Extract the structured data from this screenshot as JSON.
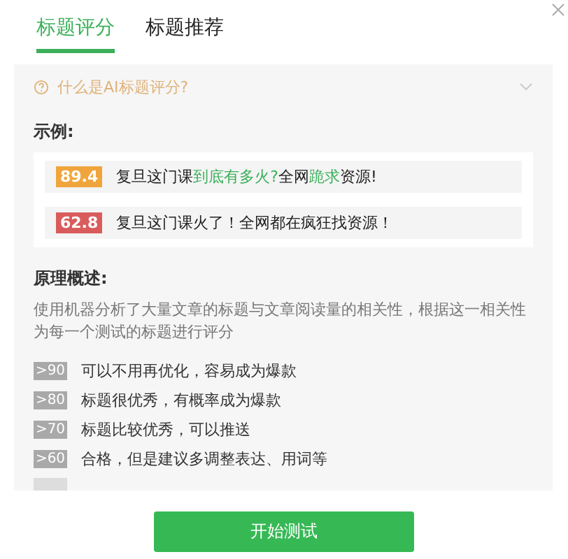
{
  "tabs": [
    {
      "label": "标题评分",
      "selected": true
    },
    {
      "label": "标题推荐",
      "selected": false
    }
  ],
  "faq": {
    "question": "什么是AI标题评分?",
    "expanded": false
  },
  "examples_heading": "示例:",
  "examples": [
    {
      "score": "89.4",
      "title": "复旦这门课**到底有多火?**全网**跪求**资源!",
      "color": "#f0a53c"
    },
    {
      "score": "62.8",
      "title": "复旦这门课火了！全网都在疯狂找资源！",
      "color": "#d95c5c"
    }
  ],
  "principle_heading": "原理概述:",
  "principle_text": "使用机器分析了大量文章的标题与文章阅读量的相关性，根据这一相关性为每一个测试的标题进行评分",
  "grades": [
    {
      "range": ">90",
      "meaning": "可以不用再优化，容易成为爆款"
    },
    {
      "range": ">80",
      "meaning": "标题很优秀，有概率成为爆款"
    },
    {
      "range": ">70",
      "meaning": "标题比较优秀，可以推送"
    },
    {
      "range": ">60",
      "meaning": "合格，但是建议多调整表达、用词等"
    }
  ],
  "start_button": "开始测试"
}
